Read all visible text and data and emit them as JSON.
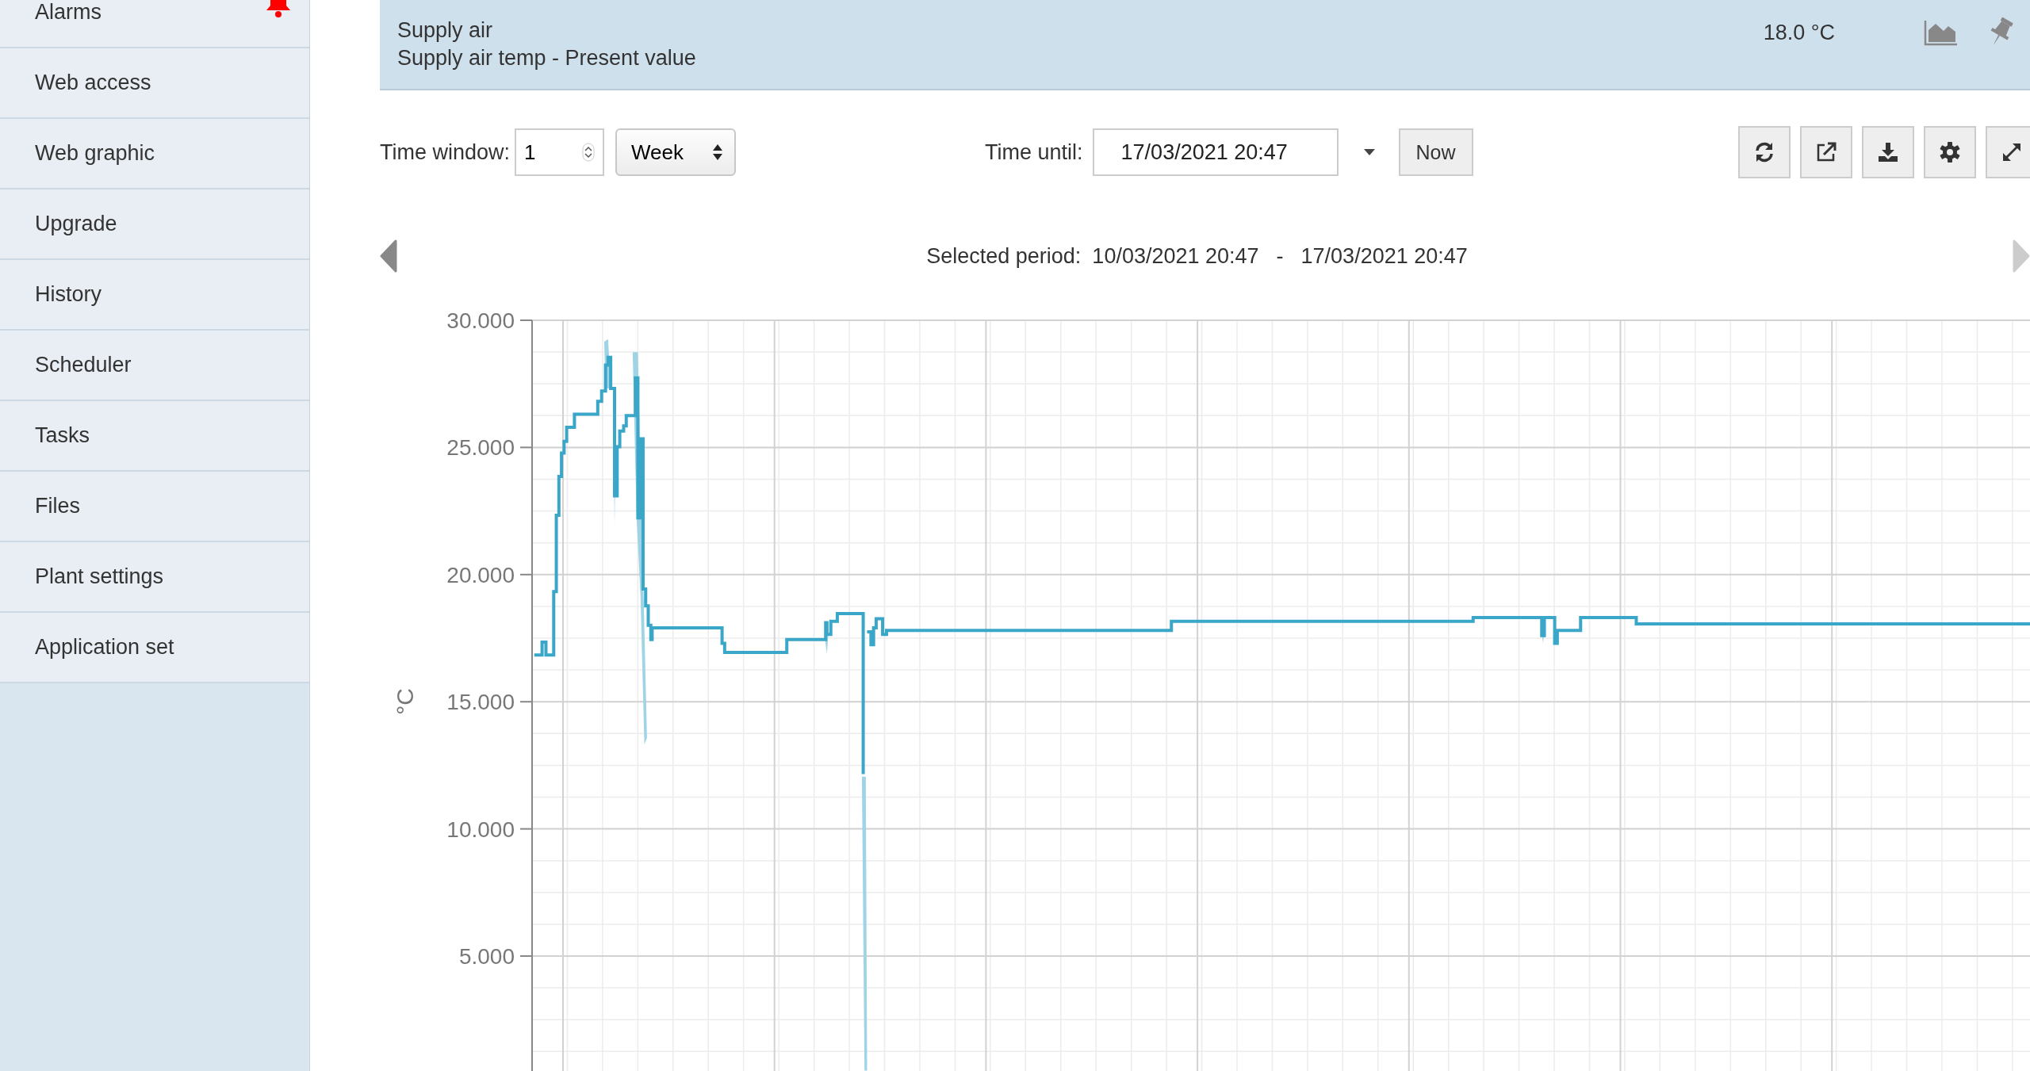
{
  "sidebar": {
    "items": [
      {
        "label": "Alarms",
        "bell": true
      },
      {
        "label": "Web access",
        "bell": false
      },
      {
        "label": "Web graphic",
        "bell": false
      },
      {
        "label": "Upgrade",
        "bell": false
      },
      {
        "label": "History",
        "bell": false
      },
      {
        "label": "Scheduler",
        "bell": false
      },
      {
        "label": "Tasks",
        "bell": false
      },
      {
        "label": "Files",
        "bell": false
      },
      {
        "label": "Plant settings",
        "bell": false
      },
      {
        "label": "Application set",
        "bell": false
      }
    ]
  },
  "point": {
    "name": "Supply air",
    "description": "Supply air temp - Present value",
    "value": "18.0 °C"
  },
  "controls": {
    "time_window_label": "Time window:",
    "time_window_value": "1",
    "unit": "Week",
    "time_until_label": "Time until:",
    "time_until_value": "17/03/2021 20:47",
    "now_button": "Now"
  },
  "period": {
    "label": "Selected period:",
    "from": "10/03/2021 20:47",
    "separator": "-",
    "to": "17/03/2021 20:47"
  },
  "chart": {
    "y_unit": "°C",
    "y_ticks": [
      "30.000",
      "25.000",
      "20.000",
      "15.000",
      "10.000",
      "5.000"
    ]
  }
}
